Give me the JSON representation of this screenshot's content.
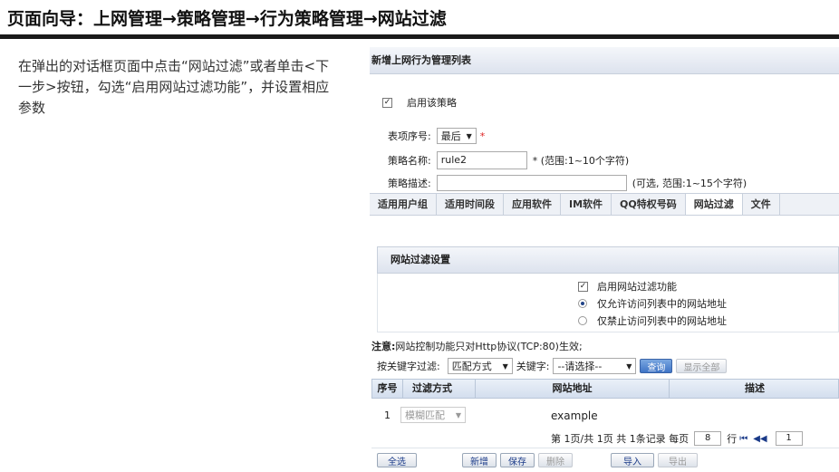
{
  "page_title": "页面向导：上网管理→策略管理→行为策略管理→网站过滤",
  "instruction": "在弹出的对话框页面中点击“网站过滤”或者单击<下一步>按钮，勾选“启用网站过滤功能”，并设置相应参数",
  "dialog": {
    "title": "新增上网行为管理列表",
    "enable_policy": {
      "label": "启用该策略",
      "checked": true
    },
    "index": {
      "label": "表项序号:",
      "value": "最后"
    },
    "name": {
      "label": "策略名称:",
      "value": "rule2",
      "hint": "* (范围:1~10个字符)"
    },
    "desc": {
      "label": "策略描述:",
      "value": "",
      "hint": "(可选, 范围:1~15个字符)"
    },
    "tabs": [
      "适用用户组",
      "适用时间段",
      "应用软件",
      "IM软件",
      "QQ特权号码",
      "网站过滤",
      "文件"
    ],
    "active_tab": 5,
    "filter": {
      "section_title": "网站过滤设置",
      "enable": {
        "label": "启用网站过滤功能",
        "checked": true
      },
      "allow_only": {
        "label": "仅允许访问列表中的网站地址",
        "selected": true
      },
      "deny_only": {
        "label": "仅禁止访问列表中的网站地址",
        "selected": false
      },
      "note_bold": "注意:",
      "note": "网站控制功能只对Http协议(TCP:80)生效;",
      "kw_filter_label": "按关键字过滤:",
      "match_select": "匹配方式",
      "kw_label": "关键字:",
      "kw_select": "--请选择--",
      "query_btn": "查询",
      "show_all_btn": "显示全部"
    },
    "table": {
      "headers": [
        "序号",
        "过滤方式",
        "网站地址",
        "描述"
      ],
      "rows": [
        {
          "index": "1",
          "mode": "模糊匹配",
          "url": "example"
        }
      ]
    },
    "pager": {
      "summary": "第 1页/共 1页 共 1条记录 每页",
      "per_page": "8",
      "per_page_unit": "行",
      "first": "⏮",
      "prev": "◀◀",
      "page": "1"
    },
    "buttons": {
      "select_all": "全选",
      "add": "新增",
      "save": "保存",
      "delete": "删除",
      "import": "导入",
      "export": "导出"
    }
  }
}
